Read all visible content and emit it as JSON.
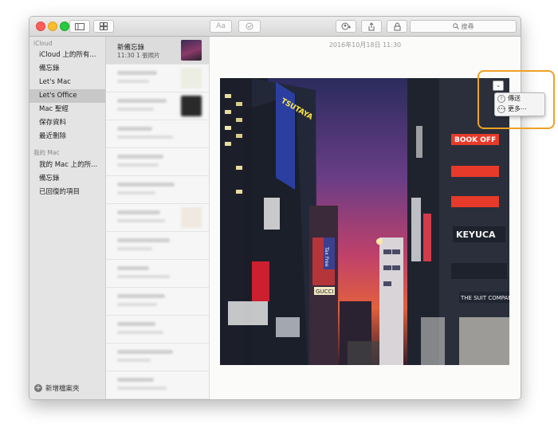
{
  "toolbar": {
    "font_label": "Aa",
    "search_placeholder": "搜尋"
  },
  "sidebar": {
    "sections": [
      {
        "title": "iCloud",
        "items": [
          "iCloud 上的所有...",
          "備忘錄",
          "Let's Mac",
          "Let's Office",
          "Mac 聖經",
          "保存資料",
          "最近刪除"
        ]
      },
      {
        "title": "我的 Mac",
        "items": [
          "我的 Mac 上的所...",
          "備忘錄",
          "已回復的項目"
        ]
      }
    ],
    "selected": "Let's Office",
    "new_folder": "新增檔案夾"
  },
  "notes": {
    "first": {
      "title": "新備忘錄",
      "subtitle": "11:30  1 張照片"
    }
  },
  "content": {
    "date": "2016年10月18日 11:30",
    "photo_signs": [
      "TSUTAYA",
      "BOOK OFF",
      "KEYUCA",
      "THE SUIT COMPANY",
      "GUCCI",
      "Tax Free"
    ]
  },
  "popup": {
    "items": [
      {
        "label": "傳送",
        "icon": "share-icon"
      },
      {
        "label": "更多⋯",
        "icon": "more-icon"
      }
    ]
  },
  "colors": {
    "accent_callout": "#f0a024",
    "close": "#fc5f57",
    "minimize": "#fdbc2e",
    "maximize": "#28c840"
  }
}
